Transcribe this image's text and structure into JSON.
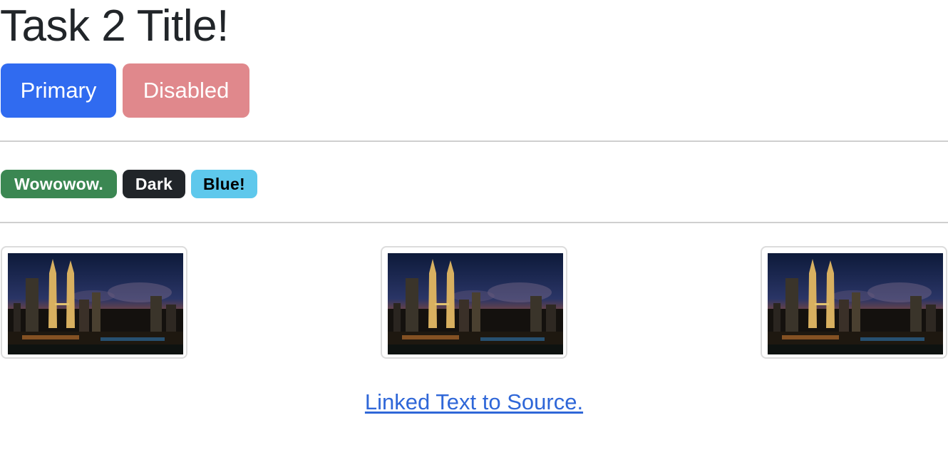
{
  "page": {
    "title": "Task 2 Title!"
  },
  "buttons": {
    "primary_label": "Primary",
    "disabled_label": "Disabled"
  },
  "badges": [
    {
      "label": "Wowowow.",
      "color": "#3b8752"
    },
    {
      "label": "Dark",
      "color": "#212529"
    },
    {
      "label": "Blue!",
      "color": "#5ec8ec"
    }
  ],
  "thumbnails": [
    {
      "icon": "city-skyline-night-image"
    },
    {
      "icon": "city-skyline-night-image"
    },
    {
      "icon": "city-skyline-night-image"
    }
  ],
  "link": {
    "text": "Linked Text to Source."
  },
  "colors": {
    "primary": "#306bf0",
    "disabled": "#e0888c",
    "link": "#2f67d8"
  }
}
